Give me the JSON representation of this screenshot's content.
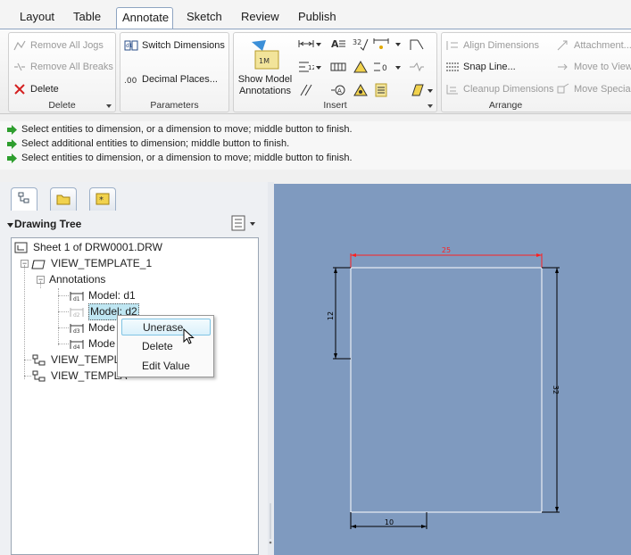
{
  "ribbon_tabs": [
    "Layout",
    "Table",
    "Annotate",
    "Sketch",
    "Review",
    "Publish"
  ],
  "active_tab": "Annotate",
  "groups": {
    "delete": {
      "label": "Delete",
      "items": [
        "Remove All Jogs",
        "Remove All Breaks",
        "Delete"
      ]
    },
    "parameters": {
      "label": "Parameters",
      "items": [
        "Switch Dimensions",
        "Decimal Places..."
      ]
    },
    "insert": {
      "label": "Insert",
      "show_model_line1": "Show Model",
      "show_model_line2": "Annotations",
      "tol_label": "32",
      "zero_label": "0"
    },
    "arrange": {
      "label": "Arrange",
      "items": [
        "Align Dimensions",
        "Snap Line...",
        "Cleanup Dimensions",
        "Attachment...",
        "Move to View",
        "Move Special"
      ]
    }
  },
  "messages": [
    "Select entities to dimension, or a dimension to move; middle button to finish.",
    "Select additional entities to dimension; middle button to finish.",
    "Select entities to dimension, or a dimension to move; middle button to finish."
  ],
  "tree": {
    "title": "Drawing Tree",
    "nodes": [
      "Sheet 1 of DRW0001.DRW",
      "VIEW_TEMPLATE_1",
      "Annotations",
      "Model: d1",
      "Model: d2",
      "Mode",
      "Mode",
      "VIEW_TEMPLA",
      "VIEW_TEMPLA"
    ]
  },
  "context_menu": [
    "Unerase",
    "Delete",
    "Edit Value"
  ],
  "drawing": {
    "dim_top": "25",
    "dim_left": "12",
    "dim_right": "32",
    "dim_bottom": "10"
  },
  "colors": {
    "canvas_bg": "#7f9abf",
    "sheet_line": "#ffffff",
    "dim_line": "#000000",
    "highlight_dim": "#ff2020",
    "tab_border": "#8ea4c1",
    "message_arrow": "#2e9e2e"
  }
}
